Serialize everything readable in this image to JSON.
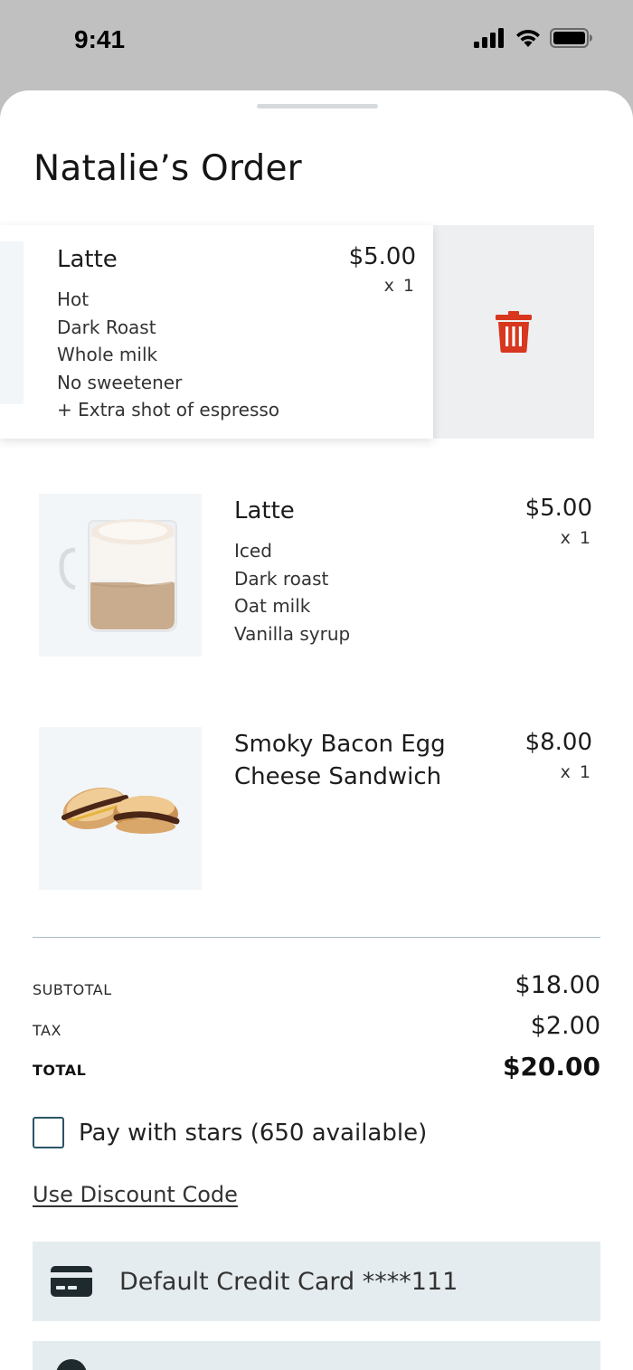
{
  "status_bar": {
    "time": "9:41"
  },
  "order": {
    "title": "Natalie’s Order",
    "items": [
      {
        "name": "Latte",
        "price": "$5.00",
        "qty": "x 1",
        "options": [
          "Hot",
          "Dark Roast",
          "Whole milk",
          "No sweetener",
          "+ Extra shot of espresso"
        ],
        "swiped": true
      },
      {
        "name": "Latte",
        "price": "$5.00",
        "qty": "x 1",
        "options": [
          "Iced",
          "Dark roast",
          "Oat milk",
          "Vanilla syrup"
        ],
        "image": "latte-photo"
      },
      {
        "name_line1": "Smoky Bacon Egg",
        "name_line2": "Cheese Sandwich",
        "price": "$8.00",
        "qty": "x 1",
        "image": "sandwich-photo"
      }
    ]
  },
  "summary": {
    "subtotal_label": "SUBTOTAL",
    "subtotal_value": "$18.00",
    "tax_label": "TAX",
    "tax_value": "$2.00",
    "total_label": "TOTAL",
    "total_value": "$20.00"
  },
  "stars": {
    "label": "Pay with stars (650 available)",
    "checked": false
  },
  "discount": {
    "label": "Use Discount Code"
  },
  "payment": {
    "card_label": "Default Credit Card ****111",
    "icon": "credit-card-icon"
  },
  "colors": {
    "delete_red": "#d8361f",
    "accent_teal": "#2b5566",
    "panel_bg": "#e5ecef"
  }
}
